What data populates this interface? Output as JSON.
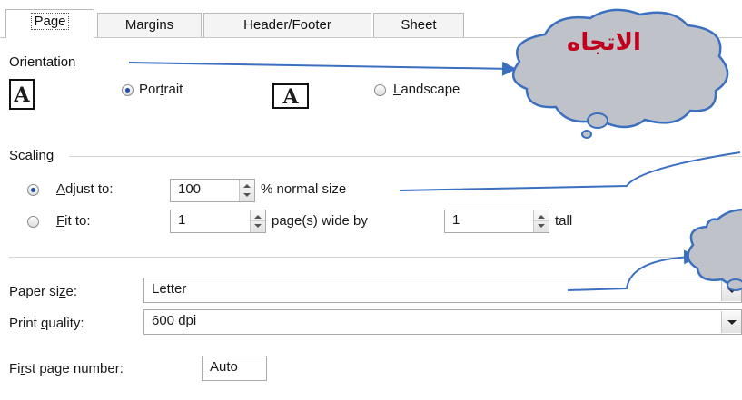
{
  "tabs": [
    {
      "label": "Page",
      "active": true
    },
    {
      "label": "Margins",
      "active": false
    },
    {
      "label": "Header/Footer",
      "active": false
    },
    {
      "label": "Sheet",
      "active": false
    }
  ],
  "orientation": {
    "title": "Orientation",
    "portrait_pre": "Por",
    "portrait_mnem": "t",
    "portrait_post": "rait",
    "landscape_mnem": "L",
    "landscape_post": "andscape",
    "selected": "portrait",
    "icon_glyph": "A"
  },
  "scaling": {
    "title": "Scaling",
    "adjust_mnem": "A",
    "adjust_post": "djust to:",
    "adjust_value": "100",
    "adjust_suffix": "% normal size",
    "fit_mnem": "F",
    "fit_post": "it to:",
    "fit_wide_value": "1",
    "fit_wide_suffix": "page(s) wide by",
    "fit_tall_value": "1",
    "fit_tall_suffix": "tall",
    "selected": "adjust"
  },
  "paper_size": {
    "label_pre": "Paper si",
    "label_mnem": "z",
    "label_post": "e:",
    "value": "Letter"
  },
  "print_quality": {
    "label_pre": "Print ",
    "label_mnem": "q",
    "label_post": "uality:",
    "value": "600 dpi"
  },
  "first_page": {
    "label_pre": "Fi",
    "label_mnem": "r",
    "label_post": "st page number:",
    "value": "Auto"
  },
  "callouts": {
    "orientation_text": "الاتجاه"
  },
  "colors": {
    "callout_fill": "#bfc3c9",
    "callout_stroke": "#3b6fc0",
    "callout_text": "#c0001c",
    "radio_dot": "#1f4fa8"
  }
}
